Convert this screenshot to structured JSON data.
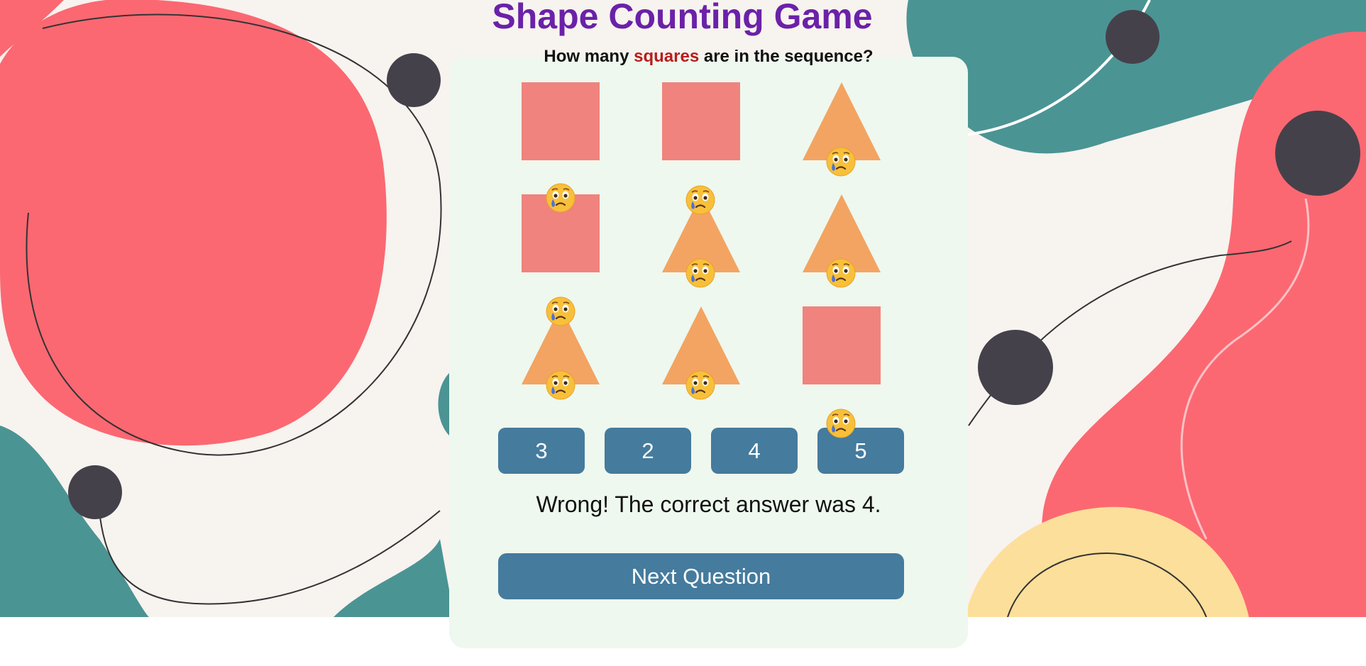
{
  "game": {
    "title": "Shape Counting Game",
    "question_prefix": "How many ",
    "question_target": "squares",
    "question_suffix": " are in the sequence?",
    "shape_colors": {
      "square": "#f0837d",
      "triangle": "#f3a462"
    },
    "grid": [
      [
        "square",
        "square",
        "triangle"
      ],
      [
        "square",
        "triangle",
        "triangle"
      ],
      [
        "triangle",
        "triangle",
        "square"
      ]
    ],
    "answers": [
      "3",
      "2",
      "4",
      "5"
    ],
    "feedback": "Wrong! The correct answer was 4.",
    "next_label": "Next Question",
    "feedback_icon": "crying-face-icon"
  },
  "theme": {
    "title_color": "#6b21a8",
    "highlight_color": "#b91c1c",
    "button_color": "#457b9d",
    "card_color": "#eef8ee"
  }
}
